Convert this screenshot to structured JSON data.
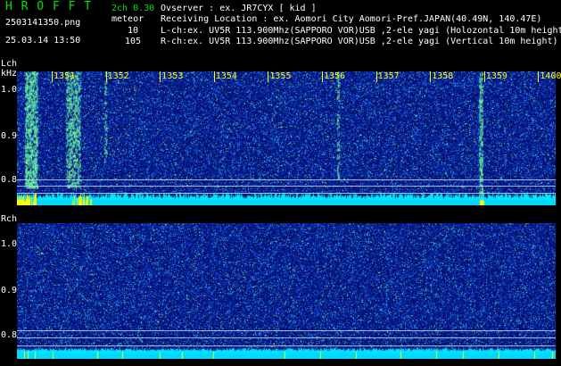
{
  "header": {
    "app_title": "H R O F F T",
    "mode": "2ch 0.30",
    "filename": "2503141350.png",
    "meteor_label": "meteor",
    "meteor_l": "10",
    "meteor_r": "105",
    "datetime": "25.03.14 13:50",
    "info_lines": [
      "Ovserver           : ex. JR7CYX [ kid ]",
      "Receiving Location : ex. Aomori City Aomori-Pref.JAPAN(40.49N, 140.47E)",
      "L-ch:ex. UV5R 113.900Mhz(SAPPORO VOR)USB ,2-ele yagi (Holozontal 10m height",
      "R-ch:ex. UV5R 113.900Mhz(SAPPORO VOR)USB ,2-ele yagi (Vertical 10m height)"
    ]
  },
  "time_axis": {
    "labels": [
      "1351",
      "1352",
      "1353",
      "1354",
      "1355",
      "1356",
      "1357",
      "1358",
      "1359",
      "1400"
    ]
  },
  "lch": {
    "channel_label": "Lch",
    "unit_label": "kHz",
    "freq_labels": [
      "1.0",
      "0.9",
      "0.8"
    ]
  },
  "rch": {
    "channel_label": "Rch",
    "freq_labels": [
      "1.0",
      "0.9",
      "0.8"
    ]
  },
  "colors": {
    "header_green": "#00e000",
    "time_label_yellow": "#ffff00",
    "signal_cyan": "#00e5ff",
    "spectrogram_blue": "#0a1a8c",
    "meteor_yellow": "#ffff00"
  }
}
